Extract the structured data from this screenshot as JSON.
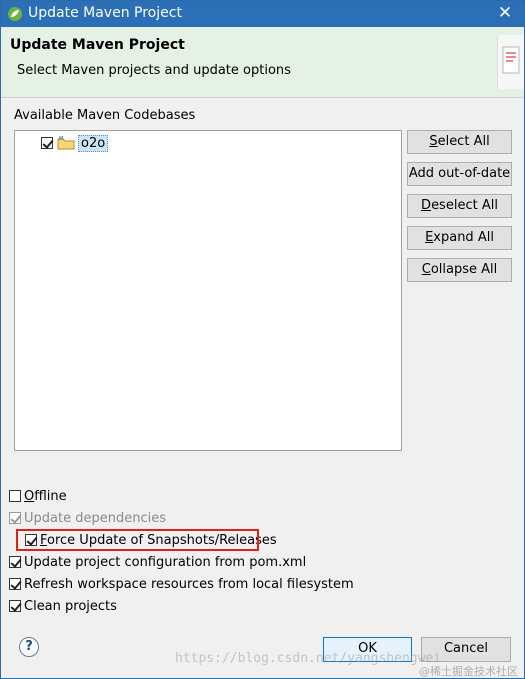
{
  "window": {
    "title": "Update Maven Project",
    "close_glyph": "✕"
  },
  "header": {
    "title": "Update Maven Project",
    "subtitle": "Select Maven projects and update options"
  },
  "codebases": {
    "label": "Available Maven Codebases",
    "items": [
      {
        "label": "o2o",
        "checked": true
      }
    ]
  },
  "side_buttons": {
    "select_all": {
      "mnemonic": "S",
      "rest": "elect All"
    },
    "add_out_of_date": {
      "label": "Add out-of-date"
    },
    "deselect_all": {
      "mnemonic": "D",
      "rest": "eselect All"
    },
    "expand_all": {
      "mnemonic": "E",
      "rest": "xpand All"
    },
    "collapse_all": {
      "mnemonic": "C",
      "rest": "ollapse All"
    }
  },
  "options": {
    "offline": {
      "mnemonic": "O",
      "rest": "ffline",
      "checked": false
    },
    "update_dependencies": {
      "label": "Update dependencies",
      "checked": true,
      "disabled": true
    },
    "force_update": {
      "mnemonic": "F",
      "rest": "orce Update of Snapshots/Releases",
      "checked": true
    },
    "update_config": {
      "label": "Update project configuration from pom.xml",
      "checked": true
    },
    "refresh_workspace": {
      "label": "Refresh workspace resources from local filesystem",
      "checked": true
    },
    "clean_projects": {
      "label": "Clean projects",
      "checked": true
    }
  },
  "footer": {
    "help_glyph": "?",
    "ok_label": "OK",
    "cancel_label": "Cancel"
  },
  "watermark": {
    "url_text": "https://blog.csdn.net/yangshengwei",
    "site_text": "@稀土掘金技术社区"
  },
  "colors": {
    "titlebar": "#2b6fb7",
    "header_bg": "#e4f1e4",
    "highlight_border": "#e02020",
    "selection_bg": "#cce4f7"
  }
}
